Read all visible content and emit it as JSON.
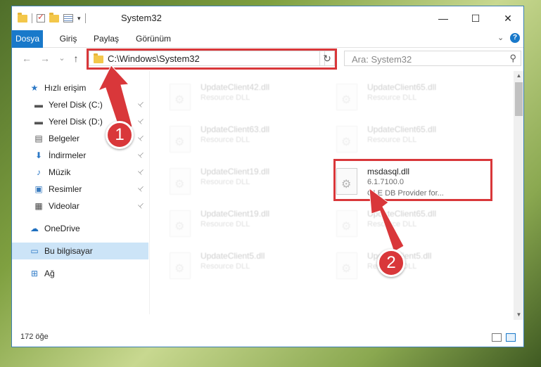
{
  "window": {
    "title": "System32",
    "controls": {
      "minimize": "—",
      "maximize": "☐",
      "close": "✕"
    }
  },
  "ribbon": {
    "tabs": [
      "Dosya",
      "Giriş",
      "Paylaş",
      "Görünüm"
    ],
    "expand_icon": "chevron-down-icon",
    "help_label": "?"
  },
  "nav": {
    "back": "←",
    "forward": "→",
    "recent": "⌄",
    "up": "↑",
    "address": "C:\\Windows\\System32",
    "refresh": "↻",
    "search_placeholder": "Ara: System32",
    "search_icon": "⚲"
  },
  "sidebar": {
    "items": [
      {
        "label": "Hızlı erişim",
        "icon": "star-icon",
        "glyph": "★",
        "color": "#2b78c6",
        "pinned": false
      },
      {
        "label": "Yerel Disk (C:)",
        "icon": "drive-icon",
        "glyph": "▬",
        "color": "#555555",
        "pinned": true
      },
      {
        "label": "Yerel Disk (D:)",
        "icon": "drive-icon",
        "glyph": "▬",
        "color": "#555555",
        "pinned": true
      },
      {
        "label": "Belgeler",
        "icon": "document-icon",
        "glyph": "▤",
        "color": "#555555",
        "pinned": true
      },
      {
        "label": "İndirmeler",
        "icon": "download-icon",
        "glyph": "⬇",
        "color": "#2b78c6",
        "pinned": true
      },
      {
        "label": "Müzik",
        "icon": "music-icon",
        "glyph": "♪",
        "color": "#2b78c6",
        "pinned": true
      },
      {
        "label": "Resimler",
        "icon": "picture-icon",
        "glyph": "▣",
        "color": "#3a7bbf",
        "pinned": true
      },
      {
        "label": "Videolar",
        "icon": "video-icon",
        "glyph": "▦",
        "color": "#444444",
        "pinned": true
      },
      {
        "label": "OneDrive",
        "icon": "cloud-icon",
        "glyph": "☁",
        "color": "#1e6fbf",
        "pinned": false
      },
      {
        "label": "Bu bilgisayar",
        "icon": "computer-icon",
        "glyph": "▭",
        "color": "#2b78c6",
        "pinned": false,
        "selected": true
      },
      {
        "label": "Ağ",
        "icon": "network-icon",
        "glyph": "⊞",
        "color": "#2b78c6",
        "pinned": false
      }
    ],
    "pin_glyph": "📌"
  },
  "files": [
    {
      "name": "UpdateClient42.dll",
      "type": "Resource DLL",
      "desc": "",
      "faded": true
    },
    {
      "name": "UpdateClient65.dll",
      "type": "Resource DLL",
      "desc": "",
      "faded": true
    },
    {
      "name": "UpdateClient63.dll",
      "type": "Resource DLL",
      "desc": "",
      "faded": true
    },
    {
      "name": "UpdateClient65.dll",
      "type": "Resource DLL",
      "desc": "",
      "faded": true
    },
    {
      "name": "UpdateClient19.dll",
      "type": "Resource DLL",
      "desc": "",
      "faded": true
    },
    {
      "name": "msdasql.dll",
      "type": "6.1.7100.0",
      "desc": "OLE DB Provider for...",
      "faded": false
    },
    {
      "name": "UpdateClient19.dll",
      "type": "Resource DLL",
      "desc": "",
      "faded": true
    },
    {
      "name": "UpdateClient65.dll",
      "type": "Resource DLL",
      "desc": "",
      "faded": true
    },
    {
      "name": "UpdateClient5.dll",
      "type": "Resource DLL",
      "desc": "",
      "faded": true
    },
    {
      "name": "UpdateClient5.dll",
      "type": "Resource DLL",
      "desc": "",
      "faded": true
    }
  ],
  "status": {
    "count": "172 öğe"
  },
  "annotations": {
    "step1": "1",
    "step2": "2",
    "highlight_color": "#d9373a"
  }
}
